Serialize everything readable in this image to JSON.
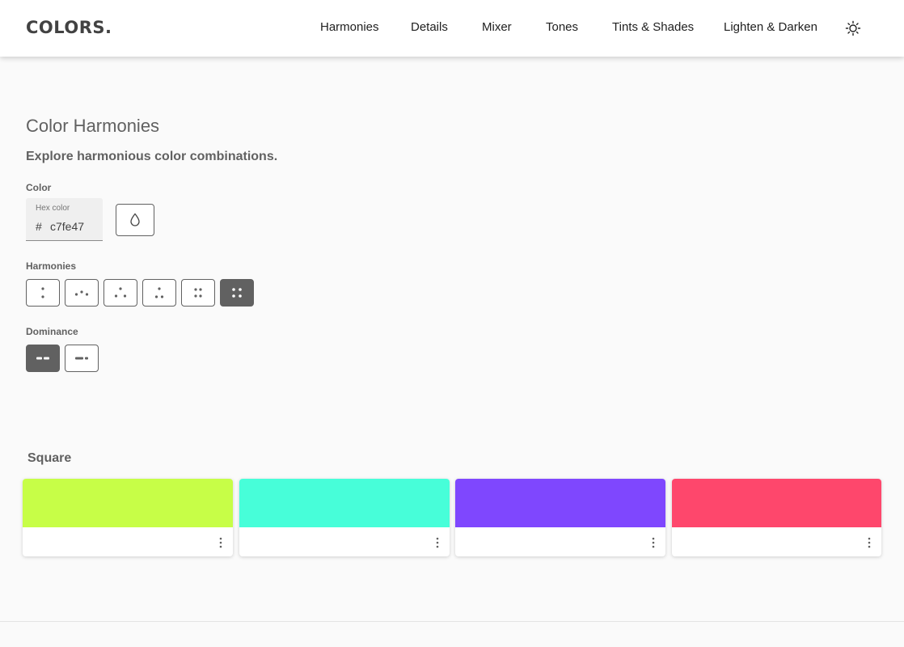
{
  "header": {
    "logo": "COLORS.",
    "nav": [
      "Harmonies",
      "Details",
      "Mixer",
      "Tones",
      "Tints & Shades",
      "Lighten & Darken"
    ],
    "theme_icon": "sun-icon"
  },
  "main": {
    "title": "Color Harmonies",
    "subtitle": "Explore harmonious color combinations.",
    "color_label": "Color",
    "hex_field": {
      "label": "Hex color",
      "prefix": "#",
      "value": "c7fe47"
    },
    "picker_icon": "droplet-icon",
    "harmonies_label": "Harmonies",
    "harmonies": [
      {
        "name": "complementary",
        "active": false
      },
      {
        "name": "analogous",
        "active": false
      },
      {
        "name": "triadic",
        "active": false
      },
      {
        "name": "split-complementary",
        "active": false
      },
      {
        "name": "rectangle",
        "active": false
      },
      {
        "name": "square",
        "active": true
      }
    ],
    "dominance_label": "Dominance",
    "dominance": [
      {
        "name": "equal",
        "active": true
      },
      {
        "name": "dominant",
        "active": false
      }
    ]
  },
  "result": {
    "title": "Square",
    "swatches": [
      {
        "color": "#c7fe47"
      },
      {
        "color": "#47fed9"
      },
      {
        "color": "#7f47fe"
      },
      {
        "color": "#fe476c"
      }
    ]
  },
  "colors": {
    "active_button": "#616161",
    "text": "#616161"
  }
}
